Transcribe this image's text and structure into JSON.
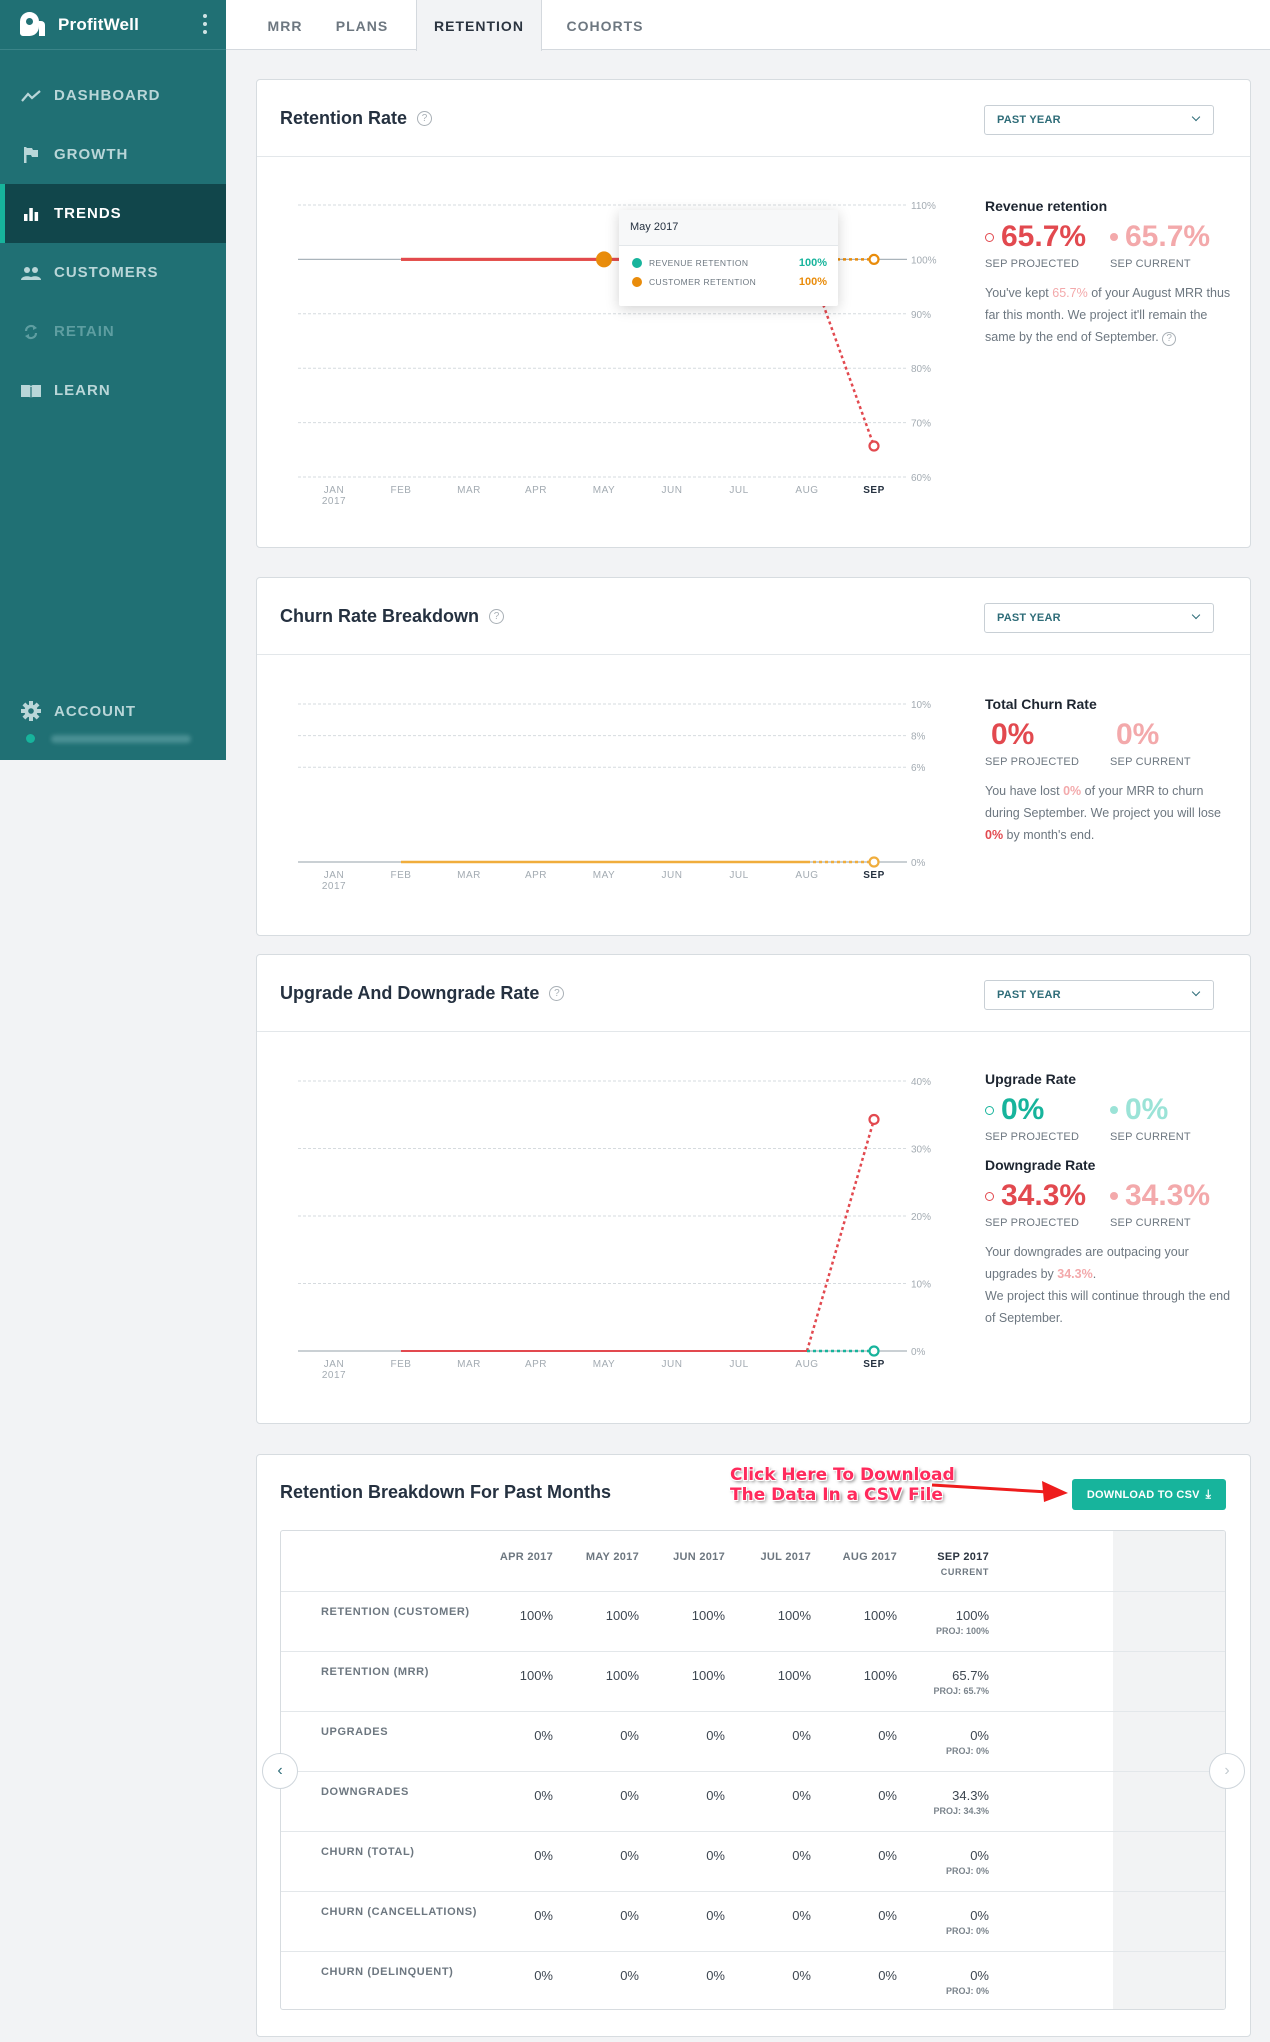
{
  "app": {
    "brand": "ProfitWell",
    "colors": {
      "sidebar": "#207074",
      "active": "#11464b",
      "accent": "#17b49c",
      "orange": "#e98c0b",
      "red": "#e2494f"
    }
  },
  "sidebar": {
    "items": [
      {
        "label": "DASHBOARD",
        "icon": "trend-line-icon",
        "active": false,
        "disabled": false
      },
      {
        "label": "GROWTH",
        "icon": "flag-icon",
        "active": false,
        "disabled": false
      },
      {
        "label": "TRENDS",
        "icon": "bar-chart-icon",
        "active": true,
        "disabled": false
      },
      {
        "label": "CUSTOMERS",
        "icon": "people-icon",
        "active": false,
        "disabled": false
      },
      {
        "label": "RETAIN",
        "icon": "refresh-icon",
        "active": false,
        "disabled": true
      },
      {
        "label": "LEARN",
        "icon": "book-icon",
        "active": false,
        "disabled": false
      }
    ],
    "account_label": "ACCOUNT"
  },
  "tabs": [
    {
      "label": "MRR",
      "active": false
    },
    {
      "label": "PLANS",
      "active": false
    },
    {
      "label": "RETENTION",
      "active": true
    },
    {
      "label": "COHORTS",
      "active": false
    }
  ],
  "retention_rate": {
    "title": "Retention Rate",
    "help": "?",
    "range": "PAST YEAR",
    "side": {
      "title": "Revenue retention",
      "projected": "65.7%",
      "projected_caption": "SEP PROJECTED",
      "current": "65.7%",
      "current_caption": "SEP CURRENT",
      "text_1": "You've kept ",
      "text_hl": "65.7%",
      "text_2": " of your August MRR thus far this month. We project it'll remain the same by the end of September.",
      "help": "?"
    },
    "tooltip": {
      "title": "May 2017",
      "rows": [
        {
          "label": "REVENUE RETENTION",
          "value": "100%",
          "color": "#17b49c"
        },
        {
          "label": "CUSTOMER RETENTION",
          "value": "100%",
          "color": "#e98c0b"
        }
      ]
    }
  },
  "churn": {
    "title": "Churn Rate Breakdown",
    "help": "?",
    "range": "PAST YEAR",
    "side": {
      "title": "Total Churn Rate",
      "projected": "0%",
      "projected_caption": "SEP PROJECTED",
      "current": "0%",
      "current_caption": "SEP CURRENT",
      "text_1": "You have lost ",
      "text_hl": "0%",
      "text_2": " of your MRR to churn during September. We project you will lose ",
      "text_hl2": "0%",
      "text_3": " by month's end."
    }
  },
  "updown": {
    "title": "Upgrade And Downgrade Rate",
    "help": "?",
    "range": "PAST YEAR",
    "side": {
      "up_title": "Upgrade Rate",
      "up_projected": "0%",
      "up_current": "0%",
      "down_title": "Downgrade Rate",
      "down_projected": "34.3%",
      "down_current": "34.3%",
      "projected_caption": "SEP PROJECTED",
      "current_caption": "SEP CURRENT",
      "text_1": "Your downgrades are outpacing your upgrades by ",
      "text_hl": "34.3%",
      "text_2": ".",
      "text_3": "We project this will continue through the end of September."
    }
  },
  "breakdown": {
    "title": "Retention Breakdown For Past Months",
    "annotation_line1": "Click Here To Download",
    "annotation_line2": "The Data In a CSV File",
    "download_label": "DOWNLOAD TO CSV",
    "download_icon": "⤓",
    "columns": [
      "APR 2017",
      "MAY 2017",
      "JUN 2017",
      "JUL 2017",
      "AUG 2017",
      "SEP 2017"
    ],
    "current_sub": "CURRENT",
    "rows": [
      {
        "label": "RETENTION (CUSTOMER)",
        "values": [
          "100%",
          "100%",
          "100%",
          "100%",
          "100%",
          "100%"
        ],
        "proj": "PROJ: 100%"
      },
      {
        "label": "RETENTION (MRR)",
        "values": [
          "100%",
          "100%",
          "100%",
          "100%",
          "100%",
          "65.7%"
        ],
        "proj": "PROJ: 65.7%"
      },
      {
        "label": "UPGRADES",
        "values": [
          "0%",
          "0%",
          "0%",
          "0%",
          "0%",
          "0%"
        ],
        "proj": "PROJ: 0%"
      },
      {
        "label": "DOWNGRADES",
        "values": [
          "0%",
          "0%",
          "0%",
          "0%",
          "0%",
          "34.3%"
        ],
        "proj": "PROJ: 34.3%"
      },
      {
        "label": "CHURN (TOTAL)",
        "values": [
          "0%",
          "0%",
          "0%",
          "0%",
          "0%",
          "0%"
        ],
        "proj": "PROJ: 0%"
      },
      {
        "label": "CHURN (CANCELLATIONS)",
        "values": [
          "0%",
          "0%",
          "0%",
          "0%",
          "0%",
          "0%"
        ],
        "proj": "PROJ: 0%"
      },
      {
        "label": "CHURN (DELINQUENT)",
        "values": [
          "0%",
          "0%",
          "0%",
          "0%",
          "0%",
          "0%"
        ],
        "proj": "PROJ: 0%"
      }
    ]
  },
  "chart_data": [
    {
      "type": "line",
      "title": "Retention Rate",
      "categories": [
        "JAN 2017",
        "FEB",
        "MAR",
        "APR",
        "MAY",
        "JUN",
        "JUL",
        "AUG",
        "SEP"
      ],
      "x_ticks": [
        [
          "JAN",
          "2017"
        ],
        [
          "FEB"
        ],
        [
          "MAR"
        ],
        [
          "APR"
        ],
        [
          "MAY"
        ],
        [
          "JUN"
        ],
        [
          "JUL"
        ],
        [
          "AUG"
        ],
        [
          "SEP"
        ]
      ],
      "y_ticks": [
        60,
        70,
        80,
        90,
        100,
        110
      ],
      "y_tick_labels": [
        "60%",
        "70%",
        "80%",
        "90%",
        "100%",
        "110%"
      ],
      "ylim": [
        60,
        110
      ],
      "grid": true,
      "series": [
        {
          "name": "Customer Retention",
          "color": "#e98c0b",
          "values": [
            null,
            100,
            100,
            100,
            100,
            100,
            100,
            100,
            100
          ],
          "projected_from": 7
        },
        {
          "name": "Revenue Retention",
          "color": "#e2494f",
          "values": [
            null,
            100,
            100,
            100,
            100,
            100,
            100,
            100,
            65.7
          ],
          "projected_from": 7
        }
      ],
      "highlight_index": 4
    },
    {
      "type": "line",
      "title": "Churn Rate Breakdown",
      "categories": [
        "JAN 2017",
        "FEB",
        "MAR",
        "APR",
        "MAY",
        "JUN",
        "JUL",
        "AUG",
        "SEP"
      ],
      "x_ticks": [
        [
          "JAN",
          "2017"
        ],
        [
          "FEB"
        ],
        [
          "MAR"
        ],
        [
          "APR"
        ],
        [
          "MAY"
        ],
        [
          "JUN"
        ],
        [
          "JUL"
        ],
        [
          "AUG"
        ],
        [
          "SEP"
        ]
      ],
      "y_ticks": [
        0,
        6,
        8,
        10
      ],
      "y_tick_labels": [
        "0%",
        "6%",
        "8%",
        "10%"
      ],
      "ylim": [
        0,
        10
      ],
      "grid": true,
      "series": [
        {
          "name": "Total Churn",
          "color": "#f0ad3c",
          "values": [
            null,
            0,
            0,
            0,
            0,
            0,
            0,
            0,
            0
          ],
          "projected_from": 7
        }
      ]
    },
    {
      "type": "line",
      "title": "Upgrade And Downgrade Rate",
      "categories": [
        "JAN 2017",
        "FEB",
        "MAR",
        "APR",
        "MAY",
        "JUN",
        "JUL",
        "AUG",
        "SEP"
      ],
      "x_ticks": [
        [
          "JAN",
          "2017"
        ],
        [
          "FEB"
        ],
        [
          "MAR"
        ],
        [
          "APR"
        ],
        [
          "MAY"
        ],
        [
          "JUN"
        ],
        [
          "JUL"
        ],
        [
          "AUG"
        ],
        [
          "SEP"
        ]
      ],
      "y_ticks": [
        0,
        10,
        20,
        30,
        40
      ],
      "y_tick_labels": [
        "0%",
        "10%",
        "20%",
        "30%",
        "40%"
      ],
      "ylim": [
        0,
        40
      ],
      "grid": true,
      "series": [
        {
          "name": "Downgrade Rate",
          "color": "#e2494f",
          "values": [
            null,
            0,
            0,
            0,
            0,
            0,
            0,
            0,
            34.3
          ],
          "projected_from": 7
        },
        {
          "name": "Upgrade Rate",
          "color": "#17b49c",
          "values": [
            null,
            null,
            null,
            null,
            null,
            null,
            null,
            0,
            0
          ],
          "projected_from": 7
        }
      ]
    }
  ]
}
